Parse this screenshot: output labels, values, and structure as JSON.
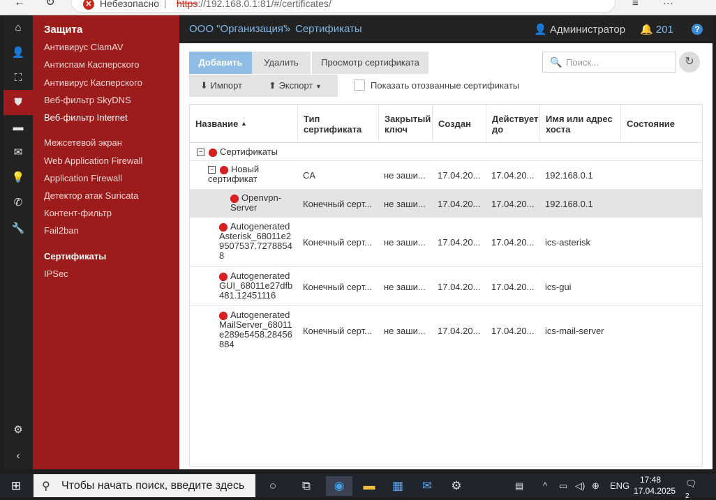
{
  "browser": {
    "insecure_label": "Небезопасно",
    "url_scheme": "https",
    "url_rest": "://192.168.0.1:81/#/certificates/"
  },
  "rail": {
    "items": [
      "home-icon",
      "user-icon",
      "network-icon",
      "shield-icon",
      "folder-icon",
      "mail-icon",
      "bulb-icon",
      "phone-icon",
      "wrench-icon"
    ],
    "active": "shield-icon"
  },
  "menu": {
    "title": "Защита",
    "items": [
      {
        "label": "Антивирус ClamAV"
      },
      {
        "label": "Антиспам Касперского"
      },
      {
        "label": "Антивирус Касперского"
      },
      {
        "label": "Веб-фильтр SkyDNS"
      },
      {
        "label": "Веб-фильтр Internet"
      },
      {
        "label": "Межсетевой экран"
      },
      {
        "label": "Web Application Firewall"
      },
      {
        "label": "Application Firewall"
      },
      {
        "label": "Детектор атак Suricata"
      },
      {
        "label": "Контент-фильтр"
      },
      {
        "label": "Fail2ban"
      },
      {
        "label": "Сертификаты"
      },
      {
        "label": "IPSec"
      }
    ]
  },
  "header": {
    "org": "ООО \"Организация\"",
    "separator": "»",
    "page": "Сертификаты",
    "user": "Администратор",
    "notifications": "201",
    "help": "?"
  },
  "toolbar": {
    "add": "Добавить",
    "delete": "Удалить",
    "view": "Просмотр сертификата",
    "import": "Импорт",
    "export": "Экспорт",
    "show_revoked": "Показать отозванные сертификаты",
    "search_placeholder": "Поиск..."
  },
  "table": {
    "columns": [
      "Название",
      "Тип сертификата",
      "Закрытый ключ",
      "Создан",
      "Действует до",
      "Имя или адрес хоста",
      "Состояние"
    ],
    "group": "Сертификаты",
    "rows": [
      {
        "name": "Новый сертификат",
        "type": "CA",
        "key": "не заши...",
        "created": "17.04.20...",
        "valid": "17.04.20...",
        "host": "192.168.0.1",
        "state": ""
      },
      {
        "name": "Openvpn-Server",
        "type": "Конечный серт...",
        "key": "не заши...",
        "created": "17.04.20...",
        "valid": "17.04.20...",
        "host": "192.168.0.1",
        "state": ""
      },
      {
        "name": "Autogenerated Asterisk_68011e29507537.72788548",
        "type": "Конечный серт...",
        "key": "не заши...",
        "created": "17.04.20...",
        "valid": "17.04.20...",
        "host": "ics-asterisk",
        "state": ""
      },
      {
        "name": "Autogenerated GUI_68011e27dfb481.12451116",
        "type": "Конечный серт...",
        "key": "не заши...",
        "created": "17.04.20...",
        "valid": "17.04.20...",
        "host": "ics-gui",
        "state": ""
      },
      {
        "name": "Autogenerated MailServer_68011e289e5458.28456884",
        "type": "Конечный серт...",
        "key": "не заши...",
        "created": "17.04.20...",
        "valid": "17.04.20...",
        "host": "ics-mail-server",
        "state": ""
      }
    ]
  },
  "taskbar": {
    "search_placeholder": "Чтобы начать поиск, введите здесь",
    "lang": "ENG",
    "time": "17:48",
    "date": "17.04.2025",
    "notifications": "2"
  }
}
